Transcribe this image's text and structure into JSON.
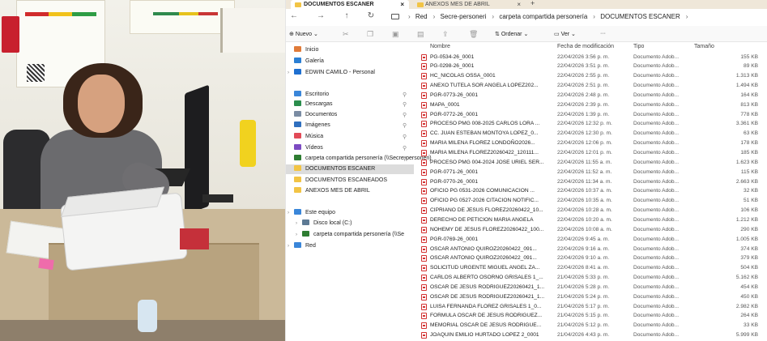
{
  "tabs": [
    {
      "label": "DOCUMENTOS ESCANER",
      "active": true
    },
    {
      "label": "ANEXOS MES DE ABRIL",
      "active": false
    }
  ],
  "nav": {
    "back": "←",
    "forward": "→",
    "up": "↑",
    "refresh": "↻",
    "breadcrumb": [
      "Red",
      "Secre-personeri",
      "carpeta compartida personería",
      "DOCUMENTOS ESCANER"
    ]
  },
  "toolbar": {
    "new_label": "Nuevo",
    "sort_label": "Ordenar",
    "view_label": "Ver",
    "more_label": "···"
  },
  "sidebar": {
    "items": [
      {
        "label": "Inicio",
        "icon": "home-icon",
        "color": "#e07b39"
      },
      {
        "label": "Galería",
        "icon": "gallery-icon",
        "color": "#2b7fd4"
      },
      {
        "label": "EDWIN CAMILO - Personal",
        "icon": "cloud-icon",
        "color": "#1e6fd0"
      },
      {
        "label": "Escritorio",
        "icon": "desktop-icon",
        "color": "#3a86d9"
      },
      {
        "label": "Descargas",
        "icon": "download-icon",
        "color": "#2a8d4c"
      },
      {
        "label": "Documentos",
        "icon": "documents-icon",
        "color": "#7a8ca3"
      },
      {
        "label": "Imágenes",
        "icon": "pictures-icon",
        "color": "#2f6fbf"
      },
      {
        "label": "Música",
        "icon": "music-icon",
        "color": "#e24a58"
      },
      {
        "label": "Vídeos",
        "icon": "videos-icon",
        "color": "#7c4bc2"
      },
      {
        "label": "carpeta compartida personería (\\\\Secre-personeri)",
        "icon": "network-folder-icon",
        "color": "#2e7d32"
      },
      {
        "label": "DOCUMENTOS ESCANER",
        "icon": "folder-icon",
        "color": "#f2c445"
      },
      {
        "label": "DOCUMENTOS ESCANEADOS",
        "icon": "folder-icon",
        "color": "#f2c445"
      },
      {
        "label": "ANEXOS MES DE ABRIL",
        "icon": "folder-icon",
        "color": "#f2c445"
      },
      {
        "label": "Este equipo",
        "icon": "computer-icon",
        "color": "#3a86d9"
      },
      {
        "label": "Disco local (C:)",
        "icon": "drive-icon",
        "color": "#5d7a94"
      },
      {
        "label": "carpeta compartida personería (\\\\Se",
        "icon": "network-drive-icon",
        "color": "#2e7d32"
      },
      {
        "label": "Red",
        "icon": "network-icon",
        "color": "#3a86d9"
      }
    ]
  },
  "columns": {
    "name": "Nombre",
    "date": "Fecha de modificación",
    "type": "Tipo",
    "size": "Tamaño"
  },
  "files": [
    {
      "name": "PG-0534-26_0001",
      "date": "22/04/2026 3:56 p. m.",
      "type": "Documento Adob...",
      "size": "155 KB"
    },
    {
      "name": "PG-0298-26_0001",
      "date": "22/04/2026 3:51 p. m.",
      "type": "Documento Adob...",
      "size": "89 KB"
    },
    {
      "name": "HC_NICOLAS OSSA_0001",
      "date": "22/04/2026 2:55 p. m.",
      "type": "Documento Adob...",
      "size": "1.313 KB"
    },
    {
      "name": "ANEXO TUTELA SOR ANGELA LOPEZ202...",
      "date": "22/04/2026 2:51 p. m.",
      "type": "Documento Adob...",
      "size": "1.494 KB"
    },
    {
      "name": "PGR-0773-26_0001",
      "date": "22/04/2026 2:48 p. m.",
      "type": "Documento Adob...",
      "size": "164 KB"
    },
    {
      "name": "MAPA_0001",
      "date": "22/04/2026 2:39 p. m.",
      "type": "Documento Adob...",
      "size": "813 KB"
    },
    {
      "name": "PGR-0772-26_0001",
      "date": "22/04/2026 1:39 p. m.",
      "type": "Documento Adob...",
      "size": "778 KB"
    },
    {
      "name": "PROCESO PMG 008-2025 CARLOS LORA ...",
      "date": "22/04/2026 12:32 p. m.",
      "type": "Documento Adob...",
      "size": "3.361 KB"
    },
    {
      "name": "CC. JUAN ESTEBAN MONTOYA LOPEZ_0...",
      "date": "22/04/2026 12:30 p. m.",
      "type": "Documento Adob...",
      "size": "63 KB"
    },
    {
      "name": "MARIA MILENA FLOREZ LONDOÑO2026...",
      "date": "22/04/2026 12:06 p. m.",
      "type": "Documento Adob...",
      "size": "178 KB"
    },
    {
      "name": "MARIA MILENA FLOREZ20260422_120111...",
      "date": "22/04/2026 12:01 p. m.",
      "type": "Documento Adob...",
      "size": "185 KB"
    },
    {
      "name": "PROCESO PMG 004-2024 JOSE URIEL SER...",
      "date": "22/04/2026 11:55 a. m.",
      "type": "Documento Adob...",
      "size": "1.623 KB"
    },
    {
      "name": "PGR-0771-26_0001",
      "date": "22/04/2026 11:52 a. m.",
      "type": "Documento Adob...",
      "size": "115 KB"
    },
    {
      "name": "PGR-0770-26_0001",
      "date": "22/04/2026 11:34 a. m.",
      "type": "Documento Adob...",
      "size": "2.663 KB"
    },
    {
      "name": "OFICIO PG 0531-2026 COMUNICACION ...",
      "date": "22/04/2026 10:37 a. m.",
      "type": "Documento Adob...",
      "size": "32 KB"
    },
    {
      "name": "OFICIO PG 0527-2026 CITACION NOTIFIC...",
      "date": "22/04/2026 10:35 a. m.",
      "type": "Documento Adob...",
      "size": "51 KB"
    },
    {
      "name": "CIPRIANO DE JESUS FLOREZ20260422_10...",
      "date": "22/04/2026 10:28 a. m.",
      "type": "Documento Adob...",
      "size": "106 KB"
    },
    {
      "name": "DERECHO DE PETICION MARIA ANGELA",
      "date": "22/04/2026 10:20 a. m.",
      "type": "Documento Adob...",
      "size": "1.212 KB"
    },
    {
      "name": "NOHEMY DE JESUS FLOREZ20260422_100...",
      "date": "22/04/2026 10:08 a. m.",
      "type": "Documento Adob...",
      "size": "290 KB"
    },
    {
      "name": "PGR-0769-26_0001",
      "date": "22/04/2026 9:45 a. m.",
      "type": "Documento Adob...",
      "size": "1.005 KB"
    },
    {
      "name": "OSCAR ANTONIO QUIROZ20260422_091...",
      "date": "22/04/2026 9:16 a. m.",
      "type": "Documento Adob...",
      "size": "374 KB"
    },
    {
      "name": "OSCAR ANTONIO QUIROZ20260422_091...",
      "date": "22/04/2026 9:10 a. m.",
      "type": "Documento Adob...",
      "size": "379 KB"
    },
    {
      "name": "SOLICITUD URGENTE MIGUEL ANGEL ZA...",
      "date": "22/04/2026 8:41 a. m.",
      "type": "Documento Adob...",
      "size": "504 KB"
    },
    {
      "name": "CARLOS ALBERTO OSORNO GRISALES 1_...",
      "date": "21/04/2026 5:33 p. m.",
      "type": "Documento Adob...",
      "size": "5.162 KB"
    },
    {
      "name": "OSCAR DE JESUS RODRIGUEZ20260421_1...",
      "date": "21/04/2026 5:28 p. m.",
      "type": "Documento Adob...",
      "size": "454 KB"
    },
    {
      "name": "OSCAR DE JESUS RODRIGUEZ20260421_1...",
      "date": "21/04/2026 5:24 p. m.",
      "type": "Documento Adob...",
      "size": "450 KB"
    },
    {
      "name": "LUISA FERNANDA FLOREZ GRISALES 1_0...",
      "date": "21/04/2026 5:17 p. m.",
      "type": "Documento Adob...",
      "size": "2.982 KB"
    },
    {
      "name": "FORMULA OSCAR DE JESUS RODRIGUEZ...",
      "date": "21/04/2026 5:15 p. m.",
      "type": "Documento Adob...",
      "size": "264 KB"
    },
    {
      "name": "MEMORIAL OSCAR DE JESUS RODRIGUE...",
      "date": "21/04/2026 5:12 p. m.",
      "type": "Documento Adob...",
      "size": "33 KB"
    },
    {
      "name": "JOAQUIN EMILIO HURTADO LOPEZ 2_0001",
      "date": "21/04/2026 4:43 p. m.",
      "type": "Documento Adob...",
      "size": "5.999 KB"
    }
  ]
}
